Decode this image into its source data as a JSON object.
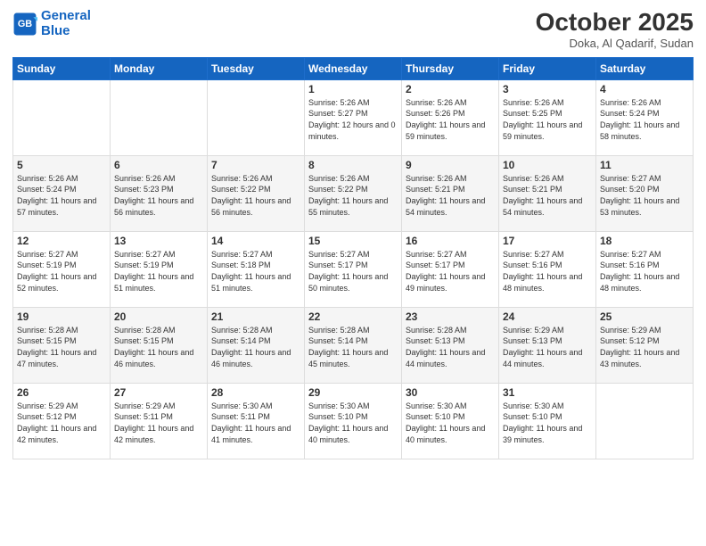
{
  "header": {
    "logo_line1": "General",
    "logo_line2": "Blue",
    "month": "October 2025",
    "location": "Doka, Al Qadarif, Sudan"
  },
  "weekdays": [
    "Sunday",
    "Monday",
    "Tuesday",
    "Wednesday",
    "Thursday",
    "Friday",
    "Saturday"
  ],
  "weeks": [
    [
      {
        "day": "",
        "sunrise": "",
        "sunset": "",
        "daylight": ""
      },
      {
        "day": "",
        "sunrise": "",
        "sunset": "",
        "daylight": ""
      },
      {
        "day": "",
        "sunrise": "",
        "sunset": "",
        "daylight": ""
      },
      {
        "day": "1",
        "sunrise": "Sunrise: 5:26 AM",
        "sunset": "Sunset: 5:27 PM",
        "daylight": "Daylight: 12 hours and 0 minutes."
      },
      {
        "day": "2",
        "sunrise": "Sunrise: 5:26 AM",
        "sunset": "Sunset: 5:26 PM",
        "daylight": "Daylight: 11 hours and 59 minutes."
      },
      {
        "day": "3",
        "sunrise": "Sunrise: 5:26 AM",
        "sunset": "Sunset: 5:25 PM",
        "daylight": "Daylight: 11 hours and 59 minutes."
      },
      {
        "day": "4",
        "sunrise": "Sunrise: 5:26 AM",
        "sunset": "Sunset: 5:24 PM",
        "daylight": "Daylight: 11 hours and 58 minutes."
      }
    ],
    [
      {
        "day": "5",
        "sunrise": "Sunrise: 5:26 AM",
        "sunset": "Sunset: 5:24 PM",
        "daylight": "Daylight: 11 hours and 57 minutes."
      },
      {
        "day": "6",
        "sunrise": "Sunrise: 5:26 AM",
        "sunset": "Sunset: 5:23 PM",
        "daylight": "Daylight: 11 hours and 56 minutes."
      },
      {
        "day": "7",
        "sunrise": "Sunrise: 5:26 AM",
        "sunset": "Sunset: 5:22 PM",
        "daylight": "Daylight: 11 hours and 56 minutes."
      },
      {
        "day": "8",
        "sunrise": "Sunrise: 5:26 AM",
        "sunset": "Sunset: 5:22 PM",
        "daylight": "Daylight: 11 hours and 55 minutes."
      },
      {
        "day": "9",
        "sunrise": "Sunrise: 5:26 AM",
        "sunset": "Sunset: 5:21 PM",
        "daylight": "Daylight: 11 hours and 54 minutes."
      },
      {
        "day": "10",
        "sunrise": "Sunrise: 5:26 AM",
        "sunset": "Sunset: 5:21 PM",
        "daylight": "Daylight: 11 hours and 54 minutes."
      },
      {
        "day": "11",
        "sunrise": "Sunrise: 5:27 AM",
        "sunset": "Sunset: 5:20 PM",
        "daylight": "Daylight: 11 hours and 53 minutes."
      }
    ],
    [
      {
        "day": "12",
        "sunrise": "Sunrise: 5:27 AM",
        "sunset": "Sunset: 5:19 PM",
        "daylight": "Daylight: 11 hours and 52 minutes."
      },
      {
        "day": "13",
        "sunrise": "Sunrise: 5:27 AM",
        "sunset": "Sunset: 5:19 PM",
        "daylight": "Daylight: 11 hours and 51 minutes."
      },
      {
        "day": "14",
        "sunrise": "Sunrise: 5:27 AM",
        "sunset": "Sunset: 5:18 PM",
        "daylight": "Daylight: 11 hours and 51 minutes."
      },
      {
        "day": "15",
        "sunrise": "Sunrise: 5:27 AM",
        "sunset": "Sunset: 5:17 PM",
        "daylight": "Daylight: 11 hours and 50 minutes."
      },
      {
        "day": "16",
        "sunrise": "Sunrise: 5:27 AM",
        "sunset": "Sunset: 5:17 PM",
        "daylight": "Daylight: 11 hours and 49 minutes."
      },
      {
        "day": "17",
        "sunrise": "Sunrise: 5:27 AM",
        "sunset": "Sunset: 5:16 PM",
        "daylight": "Daylight: 11 hours and 48 minutes."
      },
      {
        "day": "18",
        "sunrise": "Sunrise: 5:27 AM",
        "sunset": "Sunset: 5:16 PM",
        "daylight": "Daylight: 11 hours and 48 minutes."
      }
    ],
    [
      {
        "day": "19",
        "sunrise": "Sunrise: 5:28 AM",
        "sunset": "Sunset: 5:15 PM",
        "daylight": "Daylight: 11 hours and 47 minutes."
      },
      {
        "day": "20",
        "sunrise": "Sunrise: 5:28 AM",
        "sunset": "Sunset: 5:15 PM",
        "daylight": "Daylight: 11 hours and 46 minutes."
      },
      {
        "day": "21",
        "sunrise": "Sunrise: 5:28 AM",
        "sunset": "Sunset: 5:14 PM",
        "daylight": "Daylight: 11 hours and 46 minutes."
      },
      {
        "day": "22",
        "sunrise": "Sunrise: 5:28 AM",
        "sunset": "Sunset: 5:14 PM",
        "daylight": "Daylight: 11 hours and 45 minutes."
      },
      {
        "day": "23",
        "sunrise": "Sunrise: 5:28 AM",
        "sunset": "Sunset: 5:13 PM",
        "daylight": "Daylight: 11 hours and 44 minutes."
      },
      {
        "day": "24",
        "sunrise": "Sunrise: 5:29 AM",
        "sunset": "Sunset: 5:13 PM",
        "daylight": "Daylight: 11 hours and 44 minutes."
      },
      {
        "day": "25",
        "sunrise": "Sunrise: 5:29 AM",
        "sunset": "Sunset: 5:12 PM",
        "daylight": "Daylight: 11 hours and 43 minutes."
      }
    ],
    [
      {
        "day": "26",
        "sunrise": "Sunrise: 5:29 AM",
        "sunset": "Sunset: 5:12 PM",
        "daylight": "Daylight: 11 hours and 42 minutes."
      },
      {
        "day": "27",
        "sunrise": "Sunrise: 5:29 AM",
        "sunset": "Sunset: 5:11 PM",
        "daylight": "Daylight: 11 hours and 42 minutes."
      },
      {
        "day": "28",
        "sunrise": "Sunrise: 5:30 AM",
        "sunset": "Sunset: 5:11 PM",
        "daylight": "Daylight: 11 hours and 41 minutes."
      },
      {
        "day": "29",
        "sunrise": "Sunrise: 5:30 AM",
        "sunset": "Sunset: 5:10 PM",
        "daylight": "Daylight: 11 hours and 40 minutes."
      },
      {
        "day": "30",
        "sunrise": "Sunrise: 5:30 AM",
        "sunset": "Sunset: 5:10 PM",
        "daylight": "Daylight: 11 hours and 40 minutes."
      },
      {
        "day": "31",
        "sunrise": "Sunrise: 5:30 AM",
        "sunset": "Sunset: 5:10 PM",
        "daylight": "Daylight: 11 hours and 39 minutes."
      },
      {
        "day": "",
        "sunrise": "",
        "sunset": "",
        "daylight": ""
      }
    ]
  ]
}
